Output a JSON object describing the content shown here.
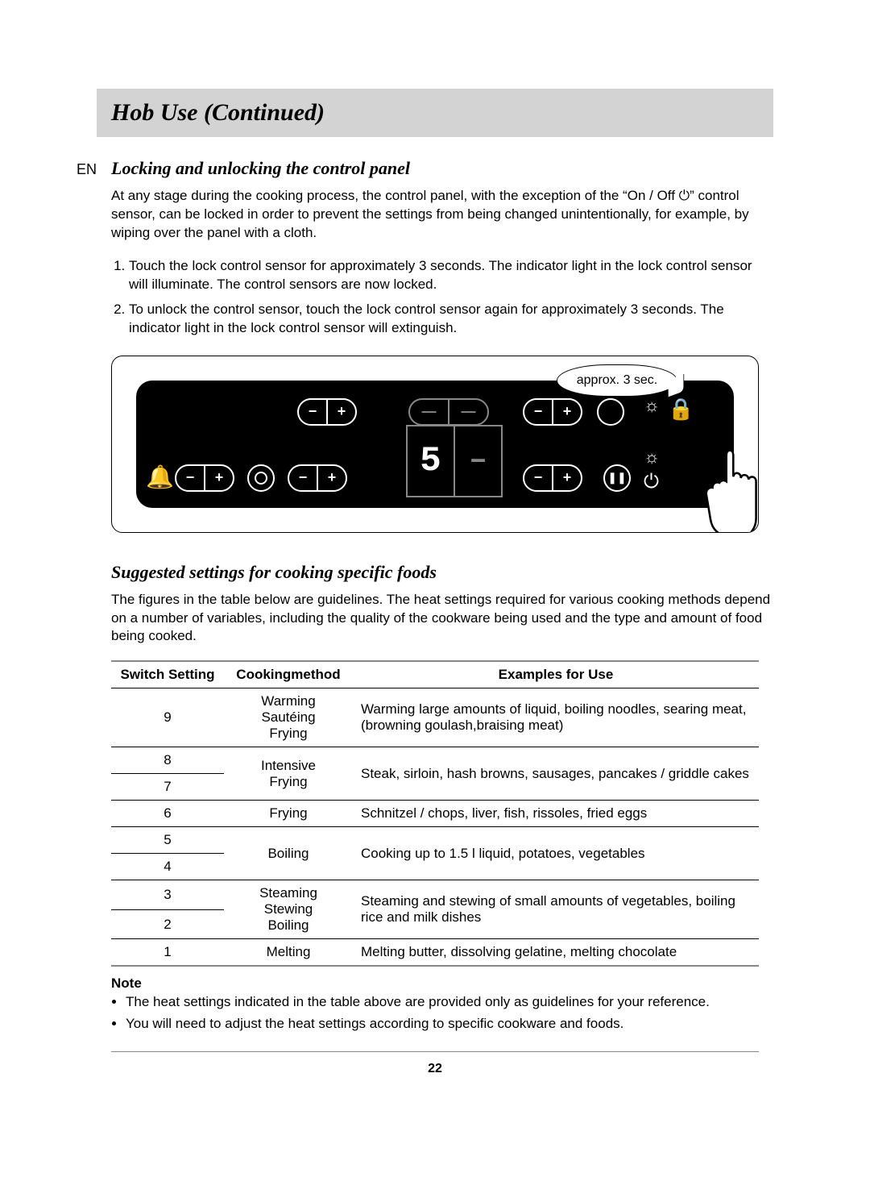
{
  "lang_tag": "EN",
  "title": "Hob Use (Continued)",
  "section1": {
    "heading": "Locking and unlocking the control panel",
    "intro": "At any stage during the cooking process, the control panel, with the exception of the “On / Off ⏻” control sensor, can be locked in order to prevent the settings from being changed unintentionally, for example, by wiping over the panel with a cloth.",
    "steps": [
      "Touch the lock control sensor for approximately 3 seconds.\nThe indicator light in the lock control sensor will illuminate. The control sensors are now locked.",
      "To unlock the control sensor, touch the lock control sensor again for approximately 3 seconds. The indicator light in the lock control sensor will extinguish."
    ],
    "bubble": "approx. 3 sec.",
    "digit_left": "5",
    "digit_right": "–"
  },
  "section2": {
    "heading": "Suggested settings for cooking specific foods",
    "intro": "The figures in the table below are guidelines. The heat settings required for various cooking methods depend on a number of variables, including the quality of the cookware being used and the type and amount of food being cooked.",
    "headers": [
      "Switch Setting",
      "Cookingmethod",
      "Examples for Use"
    ],
    "rows": [
      {
        "setting": "9",
        "method": "Warming\nSautéing\nFrying",
        "example": "Warming large amounts of liquid, boiling noodles, searing meat, (browning goulash,braising meat)"
      },
      {
        "setting": "8",
        "method_span": "Intensive\nFrying",
        "example_span": "Steak, sirloin, hash browns, sausages, pancakes / griddle cakes"
      },
      {
        "setting": "7"
      },
      {
        "setting": "6",
        "method": "Frying",
        "example": "Schnitzel / chops, liver, fish, rissoles, fried eggs"
      },
      {
        "setting": "5",
        "method_span": "Boiling",
        "example_span": "Cooking up to 1.5 l liquid, potatoes, vegetables"
      },
      {
        "setting": "4"
      },
      {
        "setting": "3",
        "method_span": "Steaming\nStewing\nBoiling",
        "example_span": "Steaming and stewing of small amounts of vegetables, boiling rice and milk dishes"
      },
      {
        "setting": "2"
      },
      {
        "setting": "1",
        "method": "Melting",
        "example": "Melting butter, dissolving gelatine, melting chocolate"
      }
    ]
  },
  "note": {
    "title": "Note",
    "items": [
      "The heat settings indicated in the table above are provided only as guidelines for your reference.",
      "You will need to adjust the heat settings according to specific cookware and foods."
    ]
  },
  "page_number": "22"
}
